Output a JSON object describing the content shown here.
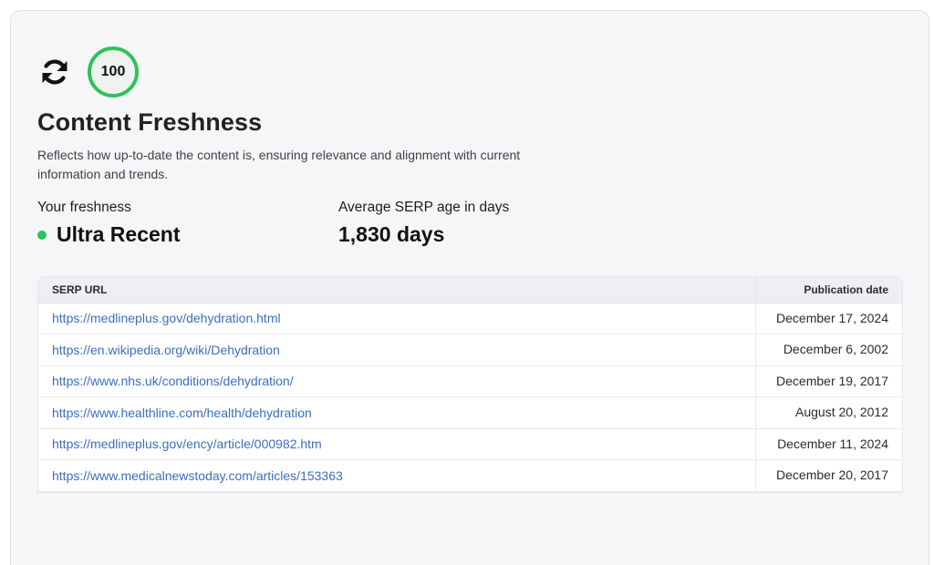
{
  "score": "100",
  "title": "Content Freshness",
  "description": "Reflects how up-to-date the content is, ensuring relevance and alignment with current information and trends.",
  "freshness": {
    "label": "Your freshness",
    "value": "Ultra Recent",
    "status_color": "#2ec25a"
  },
  "serp_age": {
    "label": "Average SERP age in days",
    "value": "1,830 days"
  },
  "table": {
    "headers": {
      "url": "SERP URL",
      "date": "Publication date"
    },
    "rows": [
      {
        "url": "https://medlineplus.gov/dehydration.html",
        "date": "December 17, 2024"
      },
      {
        "url": "https://en.wikipedia.org/wiki/Dehydration",
        "date": "December 6, 2002"
      },
      {
        "url": "https://www.nhs.uk/conditions/dehydration/",
        "date": "December 19, 2017"
      },
      {
        "url": "https://www.healthline.com/health/dehydration",
        "date": "August 20, 2012"
      },
      {
        "url": "https://medlineplus.gov/ency/article/000982.htm",
        "date": "December 11, 2024"
      },
      {
        "url": "https://www.medicalnewstoday.com/articles/153363",
        "date": "December 20, 2017"
      }
    ]
  }
}
